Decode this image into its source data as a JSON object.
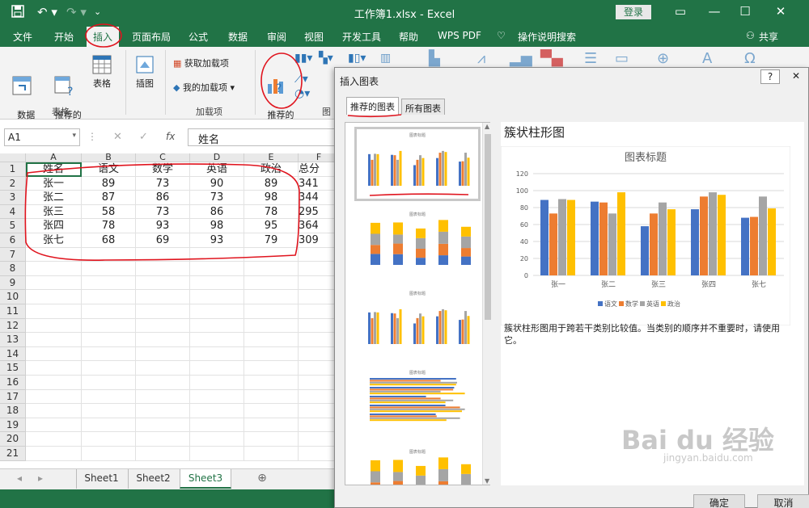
{
  "window": {
    "title": "工作簿1.xlsx  -  Excel",
    "login": "登录",
    "share": "共享"
  },
  "tabs": [
    "文件",
    "开始",
    "插入",
    "页面布局",
    "公式",
    "数据",
    "审阅",
    "视图",
    "开发工具",
    "帮助",
    "WPS PDF",
    "操作说明搜索"
  ],
  "ribbon": {
    "pivot": "数据\n透视表",
    "rec_pivot": "推荐的\n数据透视表",
    "table": "表格",
    "illustrations": "插图",
    "get_addins": "获取加载项",
    "my_addins": "我的加载项",
    "rec_charts": "推荐的\n图表",
    "group_tables": "表格",
    "group_addins": "加载项",
    "group_charts": "图"
  },
  "formula_bar": {
    "name_box": "A1",
    "fx": "fx",
    "value": "姓名"
  },
  "sheet": {
    "columns": [
      "A",
      "B",
      "C",
      "D",
      "E",
      "F"
    ],
    "rows": [
      "1",
      "2",
      "3",
      "4",
      "5",
      "6",
      "7",
      "8",
      "9",
      "10",
      "11",
      "12",
      "13",
      "14",
      "15",
      "16",
      "17",
      "18",
      "19",
      "20",
      "21"
    ],
    "cells": [
      [
        "姓名",
        "语文",
        "数学",
        "英语",
        "政治",
        "总分"
      ],
      [
        "张一",
        "89",
        "73",
        "90",
        "89",
        "341"
      ],
      [
        "张二",
        "87",
        "86",
        "73",
        "98",
        "344"
      ],
      [
        "张三",
        "58",
        "73",
        "86",
        "78",
        "295"
      ],
      [
        "张四",
        "78",
        "93",
        "98",
        "95",
        "364"
      ],
      [
        "张七",
        "68",
        "69",
        "93",
        "79",
        "309"
      ]
    ]
  },
  "sheet_tabs": [
    "Sheet1",
    "Sheet2",
    "Sheet3"
  ],
  "active_sheet": "Sheet3",
  "dialog": {
    "title": "插入图表",
    "help": "?",
    "tab_recommended": "推荐的图表",
    "tab_all": "所有图表",
    "chart_name": "簇状柱形图",
    "description": "簇状柱形图用于跨若干类别比较值。当类别的顺序并不重要时，请使用它。",
    "ok": "确定",
    "cancel": "取消",
    "thumb_title": "图表标题"
  },
  "chart_data": {
    "type": "bar",
    "title": "图表标题",
    "categories": [
      "张一",
      "张二",
      "张三",
      "张四",
      "张七"
    ],
    "series": [
      {
        "name": "语文",
        "values": [
          89,
          87,
          58,
          78,
          68
        ],
        "color": "#4472c4"
      },
      {
        "name": "数学",
        "values": [
          73,
          86,
          73,
          93,
          69
        ],
        "color": "#ed7d31"
      },
      {
        "name": "英语",
        "values": [
          90,
          73,
          86,
          98,
          93
        ],
        "color": "#a5a5a5"
      },
      {
        "name": "政治",
        "values": [
          89,
          98,
          78,
          95,
          79
        ],
        "color": "#ffc000"
      }
    ],
    "ylim": [
      0,
      120
    ],
    "yticks": [
      "0",
      "20",
      "40",
      "60",
      "80",
      "100",
      "120"
    ],
    "grid": true,
    "legend": "bottom"
  },
  "watermark": {
    "brand": "Bai du 经验",
    "url": "jingyan.baidu.com"
  },
  "colors": {
    "excel_green": "#217346",
    "annotation_red": "#e0141e"
  }
}
